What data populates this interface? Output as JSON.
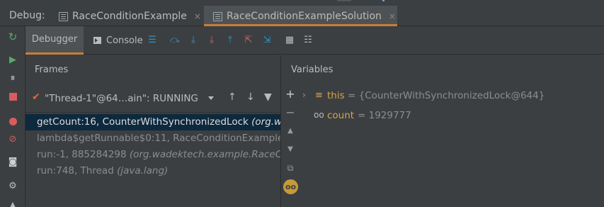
{
  "topbar": {
    "debug_label": "Debug:",
    "tabs": [
      {
        "label": "RaceConditionExample",
        "close": "×"
      },
      {
        "label": "RaceConditionExampleSolution",
        "close": "×"
      }
    ]
  },
  "subtabs": {
    "debugger": "Debugger",
    "console": "Console"
  },
  "frames": {
    "title": "Frames",
    "thread": "\"Thread-1\"@64…ain\": RUNNING",
    "list": [
      {
        "method": "getCount:16, CounterWithSynchronizedLock ",
        "pkg": "(org.w"
      },
      {
        "method": "lambda$getRunnable$0:11, RaceConditionExample",
        "pkg": ""
      },
      {
        "method": "run:-1, 885284298 ",
        "pkg": "(org.wadektech.example.RaceCon"
      },
      {
        "method": "run:748, Thread ",
        "pkg": "(java.lang)"
      }
    ]
  },
  "variables": {
    "title": "Variables",
    "items": [
      {
        "name": "this",
        "value": "= {CounterWithSynchronizedLock@644}",
        "icon": "field-icon"
      },
      {
        "name": "count",
        "value": "= 1929777",
        "icon": "watch-icon"
      }
    ]
  },
  "colors": {
    "accent": "#c77d38",
    "selection": "#0d293e",
    "var_name": "#d6a44a",
    "green": "#59a869",
    "red": "#db5c5c",
    "blue": "#3592c4"
  }
}
